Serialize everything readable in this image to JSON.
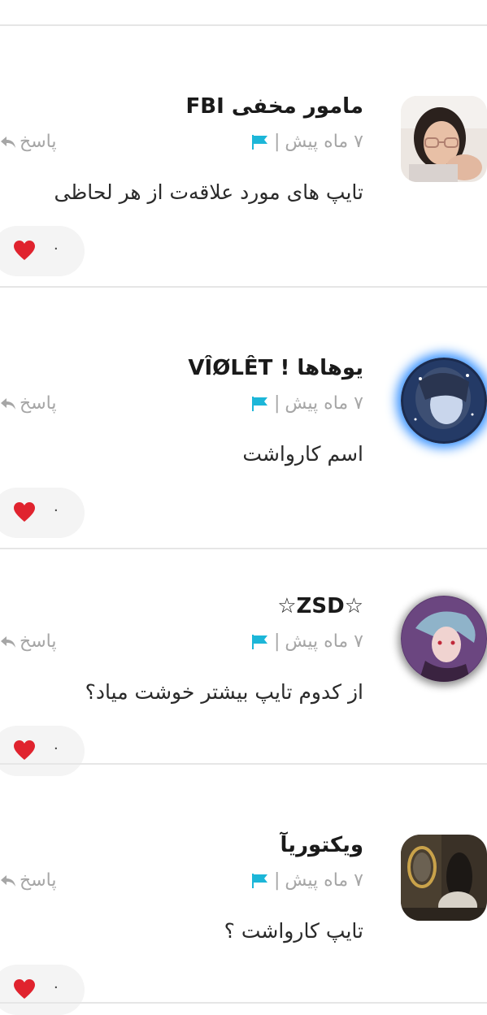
{
  "colors": {
    "divider": "#e6e6e6",
    "muted_text": "#a6a6a6",
    "flag": "#1cb6d8",
    "heart": "#e0232e",
    "pill_bg": "#f4f4f4"
  },
  "comments": [
    {
      "username": "مامور مخفی FBI",
      "flag_icon": "flag-icon",
      "separator": "|",
      "time": "۷ ماه پیش",
      "reply_label": "پاسخ",
      "body": "تایپ های مورد علاقه‌ت از هر لحاظی",
      "likes": "۰",
      "avatar_icon": "avatar-photo"
    },
    {
      "username": "یوهاها ! VÎØLÊT",
      "flag_icon": "flag-icon",
      "separator": "|",
      "time": "۷ ماه پیش",
      "reply_label": "پاسخ",
      "body": "اسم کارواشت",
      "likes": "۰",
      "avatar_icon": "avatar-anime-blue"
    },
    {
      "username": "☆ZSD☆",
      "flag_icon": "flag-icon",
      "separator": "|",
      "time": "۷ ماه پیش",
      "reply_label": "پاسخ",
      "body": "از کدوم تایپ بیشتر خوشت میاد؟",
      "likes": "۰",
      "avatar_icon": "avatar-anime-purple"
    },
    {
      "username": "ویکتوریآ",
      "flag_icon": "flag-icon",
      "separator": "|",
      "time": "۷ ماه پیش",
      "reply_label": "پاسخ",
      "body": "تایپ کارواشت ؟",
      "likes": "۰",
      "avatar_icon": "avatar-photo-room"
    }
  ]
}
